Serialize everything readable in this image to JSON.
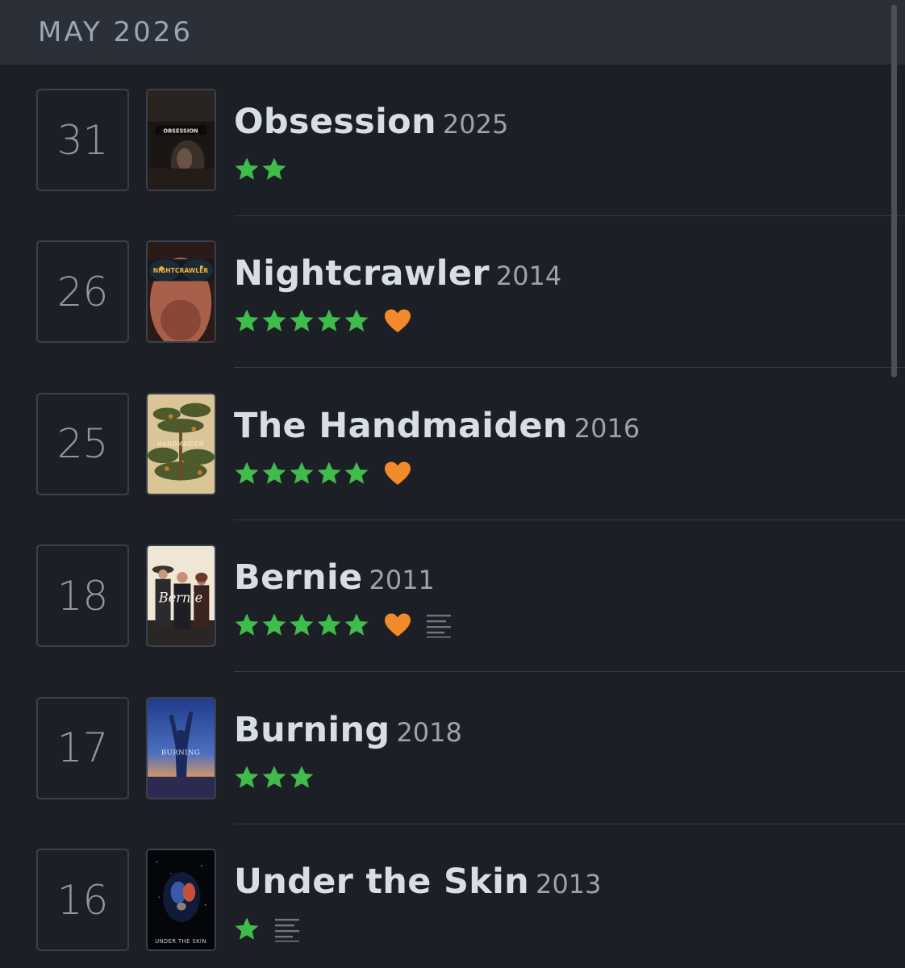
{
  "month_header": {
    "label": "MAY 2026"
  },
  "colors": {
    "star": "#40bc4a",
    "heart": "#f08a2a",
    "background": "#1c1f25",
    "header": "#2a2f38"
  },
  "entries": [
    {
      "day": "31",
      "title": "Obsession",
      "year": "2025",
      "rating": 2,
      "liked": false,
      "has_review": false,
      "poster_text": "OBSESSION",
      "poster_icon": "obsession-poster"
    },
    {
      "day": "26",
      "title": "Nightcrawler",
      "year": "2014",
      "rating": 5,
      "liked": true,
      "has_review": false,
      "poster_text": "NIGHTCRAWLER",
      "poster_icon": "nightcrawler-poster"
    },
    {
      "day": "25",
      "title": "The Handmaiden",
      "year": "2016",
      "rating": 5,
      "liked": true,
      "has_review": false,
      "poster_text": "HANDMAIDEN",
      "poster_icon": "handmaiden-poster"
    },
    {
      "day": "18",
      "title": "Bernie",
      "year": "2011",
      "rating": 5,
      "liked": true,
      "has_review": true,
      "poster_text": "Bernie",
      "poster_icon": "bernie-poster"
    },
    {
      "day": "17",
      "title": "Burning",
      "year": "2018",
      "rating": 3,
      "liked": false,
      "has_review": false,
      "poster_text": "BURNING",
      "poster_icon": "burning-poster"
    },
    {
      "day": "16",
      "title": "Under the Skin",
      "year": "2013",
      "rating": 1,
      "liked": false,
      "has_review": true,
      "poster_text": "UNDER THE SKIN",
      "poster_icon": "under-the-skin-poster"
    }
  ]
}
